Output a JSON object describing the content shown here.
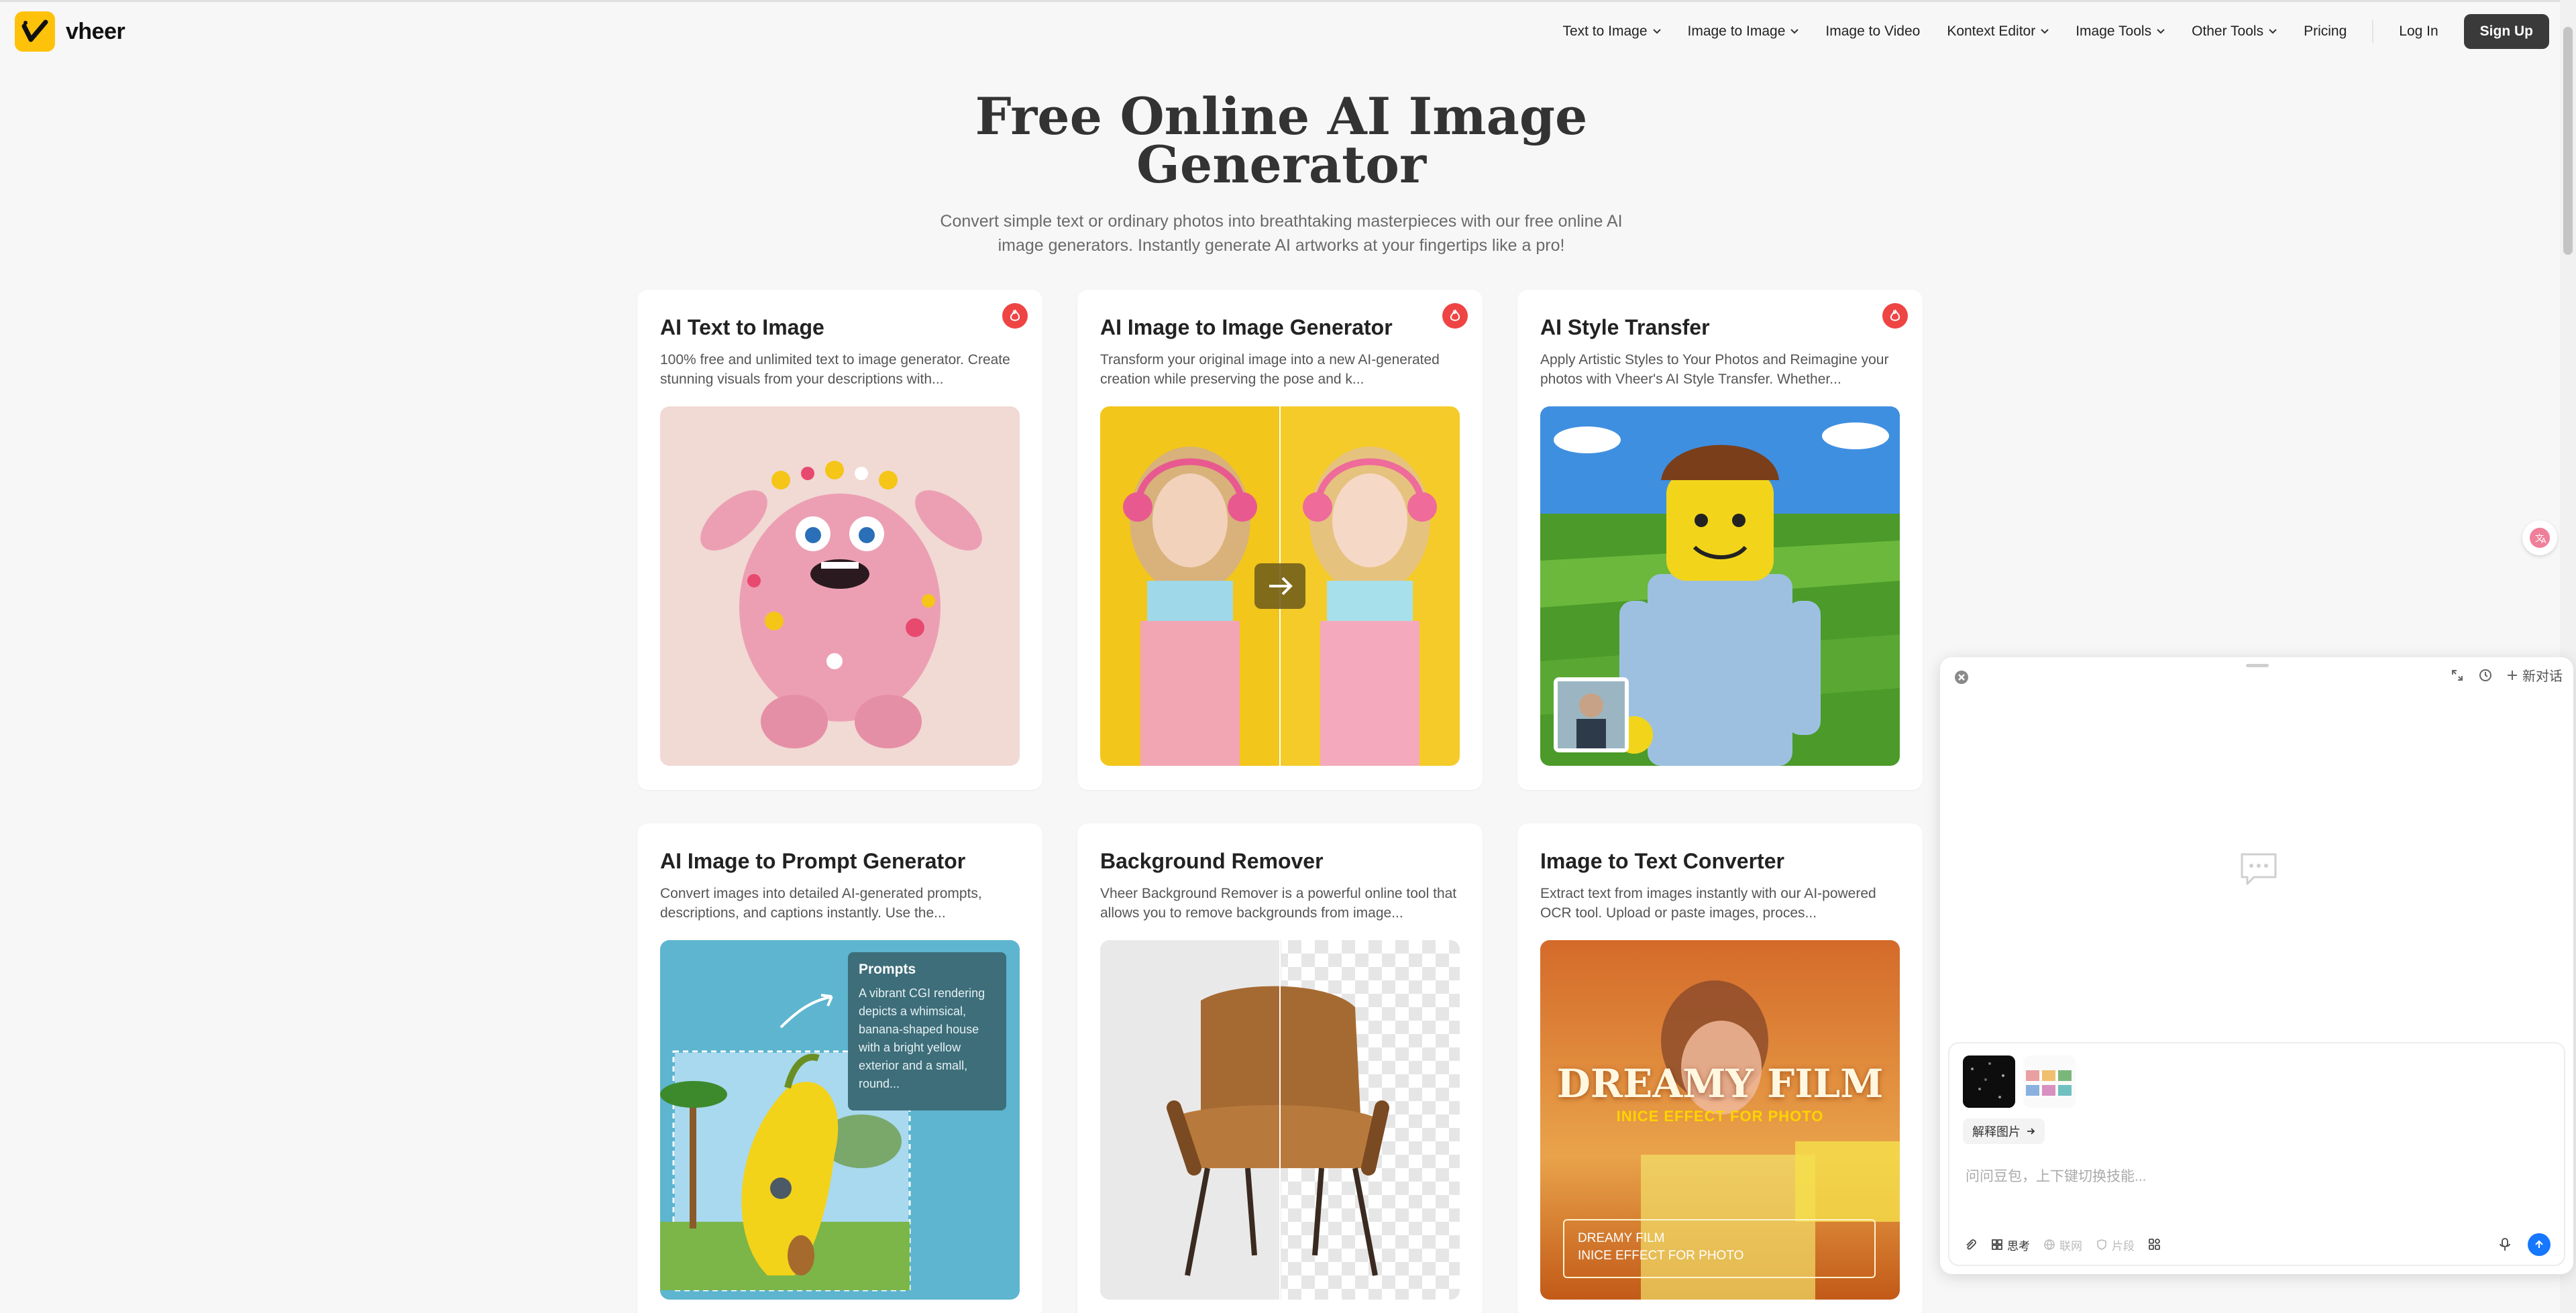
{
  "brand": {
    "name": "vheer"
  },
  "nav": {
    "items": [
      {
        "label": "Text to Image",
        "dropdown": true
      },
      {
        "label": "Image to Image",
        "dropdown": true
      },
      {
        "label": "Image to Video",
        "dropdown": false
      },
      {
        "label": "Kontext Editor",
        "dropdown": true
      },
      {
        "label": "Image Tools",
        "dropdown": true
      },
      {
        "label": "Other Tools",
        "dropdown": true
      },
      {
        "label": "Pricing",
        "dropdown": false
      }
    ],
    "login": "Log In",
    "signup": "Sign Up"
  },
  "hero": {
    "title_line1": "Free Online AI Image",
    "title_line2": "Generator",
    "subtitle": "Convert simple text or ordinary photos into breathtaking masterpieces with our free online AI image generators. Instantly generate AI artworks at your fingertips like a pro!"
  },
  "cards": [
    {
      "title": "AI Text to Image",
      "desc": "100% free and unlimited text to image generator. Create stunning visuals from your descriptions with...",
      "hot": true,
      "image": "pink-fluffy-monster"
    },
    {
      "title": "AI Image to Image Generator",
      "desc": "Transform your original image into a new AI-generated creation while preserving the pose and k...",
      "hot": true,
      "image": "girl-before-after"
    },
    {
      "title": "AI Style Transfer",
      "desc": "Apply Artistic Styles to Your Photos and Reimagine your photos with Vheer's AI Style Transfer. Whether...",
      "hot": true,
      "image": "lego-man-field"
    },
    {
      "title": "AI Image to Prompt Generator",
      "desc": "Convert images into detailed AI-generated prompts, descriptions, and captions instantly. Use the...",
      "hot": false,
      "image": "banana-house"
    },
    {
      "title": "Background Remover",
      "desc": "Vheer Background Remover is a powerful online tool that allows you to remove backgrounds from image...",
      "hot": false,
      "image": "leather-chair"
    },
    {
      "title": "Image to Text Converter",
      "desc": "Extract text from images instantly with our AI-powered OCR tool. Upload or paste images, proces...",
      "hot": false,
      "image": "dreamy-film"
    }
  ],
  "prompt_overlay": {
    "heading": "Prompts",
    "body": "A vibrant CGI rendering depicts a whimsical, banana-shaped house with a bright yellow exterior and a small, round..."
  },
  "dreamy": {
    "title": "DREAMY FILM",
    "subtitle": "INICE EFFECT FOR PHOTO",
    "box_line1": "DREAMY FILM",
    "box_line2": "INICE EFFECT FOR PHOTO"
  },
  "chat": {
    "new_chat": "新对话",
    "explain_chip": "解释图片",
    "placeholder": "问问豆包，上下键切换技能...",
    "tools": [
      {
        "label": "思考",
        "enabled": true
      },
      {
        "label": "联网",
        "enabled": false
      },
      {
        "label": "片段",
        "enabled": false
      }
    ]
  },
  "colors": {
    "accent": "#ffc20a",
    "hot": "#ef4444",
    "send": "#1677ff",
    "signup_bg": "#3a3a3a"
  }
}
